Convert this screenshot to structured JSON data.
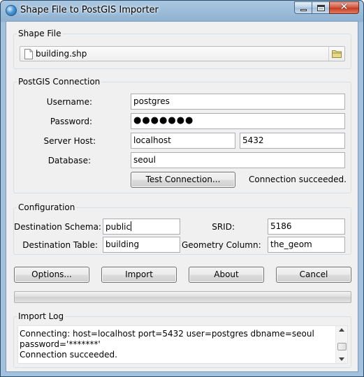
{
  "window": {
    "title": "Shape File to PostGIS Importer",
    "close_symbol": "✕"
  },
  "shape_file": {
    "group_label": "Shape File",
    "file_name": "building.shp"
  },
  "connection": {
    "group_label": "PostGIS Connection",
    "username_label": "Username:",
    "username": "postgres",
    "password_label": "Password:",
    "password_masked": "●●●●●●●",
    "server_host_label": "Server Host:",
    "host": "localhost",
    "port": "5432",
    "database_label": "Database:",
    "database": "seoul",
    "test_button": "Test Connection...",
    "status": "Connection succeeded."
  },
  "configuration": {
    "group_label": "Configuration",
    "dest_schema_label": "Destination Schema:",
    "dest_schema": "public",
    "srid_label": "SRID:",
    "srid": "5186",
    "dest_table_label": "Destination Table:",
    "dest_table": "building",
    "geom_column_label": "Geometry Column:",
    "geom_column": "the_geom"
  },
  "buttons": {
    "options": "Options...",
    "import": "Import",
    "about": "About",
    "cancel": "Cancel"
  },
  "progress": {
    "value": 0
  },
  "import_log": {
    "group_label": "Import Log",
    "lines": [
      "Connecting:  host=localhost port=5432 user=postgres dbname=seoul",
      "password='*******'",
      "Connection succeeded."
    ]
  }
}
